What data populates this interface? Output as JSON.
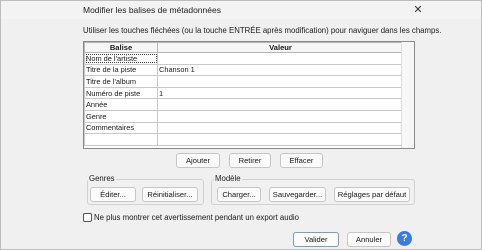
{
  "window": {
    "title": "Modifier les balises de métadonnées",
    "close_glyph": "✕"
  },
  "hint": "Utiliser les touches fléchées (ou la touche ENTRÉE après modification) pour naviguer dans les champs.",
  "table": {
    "headers": [
      "Balise",
      "Valeur"
    ],
    "rows": [
      {
        "tag": "Nom de l'artiste",
        "value": ""
      },
      {
        "tag": "Titre de la piste",
        "value": "Chanson 1"
      },
      {
        "tag": "Titre de l'album",
        "value": ""
      },
      {
        "tag": "Numéro de piste",
        "value": "1"
      },
      {
        "tag": "Année",
        "value": ""
      },
      {
        "tag": "Genre",
        "value": ""
      },
      {
        "tag": "Commentaires",
        "value": ""
      }
    ]
  },
  "row_actions": {
    "add": "Ajouter",
    "remove": "Retirer",
    "clear": "Effacer"
  },
  "genres": {
    "label": "Genres",
    "edit": "Éditer...",
    "reset": "Réinitialiser..."
  },
  "template": {
    "label": "Modèle",
    "load": "Charger...",
    "save": "Sauvegarder...",
    "defaults": "Réglages par défaut"
  },
  "dont_show": {
    "label": "Ne plus montrer cet avertissement pendant un export audio",
    "checked": false
  },
  "footer": {
    "ok": "Valider",
    "cancel": "Annuler",
    "help_glyph": "?"
  },
  "colors": {
    "help_button": "#3a7be0"
  },
  "icons": {
    "close": "close-icon",
    "help": "help-icon"
  }
}
